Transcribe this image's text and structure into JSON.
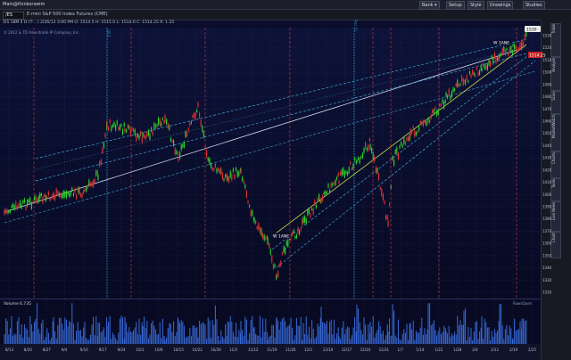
{
  "window": {
    "title": "Main@thinkorswim",
    "buttons": [
      {
        "label": "Bank ▾"
      },
      {
        "label": "Setup"
      },
      {
        "label": "Style"
      },
      {
        "label": "Drawings"
      },
      {
        "label": "Studies"
      }
    ]
  },
  "symbol": {
    "ticker": "/ES",
    "description": "E-mini S&P 500 Index Futures (CME)"
  },
  "quote_line": "/ES 18M 4 D (T-...)   2/26/13 3:00 PM   O: 1514.5   H: 1515.0   L: 1514.0   C: 1514.25   R: 1.25",
  "watermark": "© 2012 & TD Ameritrade IP Company, Inc.",
  "price_axis": {
    "ticks": [
      "1530",
      "1520",
      "1510",
      "1500",
      "1490",
      "1480",
      "1470",
      "1460",
      "1450",
      "1440",
      "1430",
      "1420",
      "1410",
      "1400",
      "1390",
      "1380",
      "1370",
      "1360",
      "1350",
      "1340",
      "1330",
      "1320"
    ],
    "current_price": "1514.25",
    "high_tag": "1530"
  },
  "time_axis": {
    "ticks": [
      "8/13",
      "8/20",
      "8/27",
      "9/4",
      "9/10",
      "9/17",
      "9/24",
      "10/1",
      "10/8",
      "10/15",
      "10/22",
      "10/29",
      "11/5",
      "11/12",
      "11/19",
      "11/26",
      "12/3",
      "12/10",
      "12/17",
      "12/24",
      "12/31",
      "1/7",
      "1/14",
      "1/22",
      "1/28",
      "2/4",
      "2/11",
      "2/19",
      "2/25"
    ]
  },
  "annotations": [
    {
      "text": "W 1ANE"
    },
    {
      "text": "W 1ANE"
    },
    {
      "text": "QE3"
    },
    {
      "text": "Fisc Cl"
    }
  ],
  "volume_panel": {
    "label": "Volume",
    "value": "6,735",
    "right_label": "RowsOpen"
  },
  "side_tabs": [
    "Trade",
    "Analyze",
    "Scan",
    "MarketWatch",
    "Charts",
    "Tools",
    "Live News",
    "Chart"
  ],
  "colors": {
    "background": "#0a0d2a",
    "grid": "#2a3470",
    "candle_up": "#2fd02f",
    "candle_down": "#e03030",
    "channel_solid": "#d9dcf0",
    "channel_dashed": "#3fa4d8",
    "trend_yellow": "#c8d84a",
    "vertical_red": "#b8303f",
    "vertical_blue": "#2aa0d0",
    "price_tag": "#cc2020",
    "volume": "#3a6ad8"
  }
}
